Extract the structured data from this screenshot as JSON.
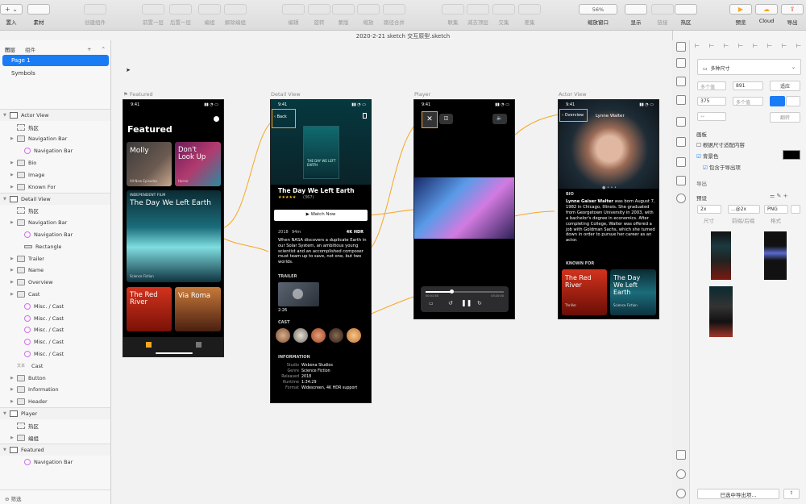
{
  "toolbar": {
    "buttons": [
      {
        "label": "置入",
        "icon": "plus-icon",
        "gray": false
      },
      {
        "label": "素材",
        "icon": "stack-icon",
        "gray": false
      },
      {
        "label": "创建组件",
        "icon": "component-icon",
        "gray": true
      },
      {
        "label": "前置一层",
        "icon": "bring-forward-icon",
        "gray": true
      },
      {
        "label": "后置一层",
        "icon": "send-backward-icon",
        "gray": true
      },
      {
        "label": "编组",
        "icon": "group-icon",
        "gray": true
      },
      {
        "label": "解除编组",
        "icon": "ungroup-icon",
        "gray": true
      },
      {
        "label": "编辑",
        "icon": "edit-icon",
        "gray": true
      },
      {
        "label": "旋转",
        "icon": "rotate-icon",
        "gray": true
      },
      {
        "label": "蒙版",
        "icon": "mask-icon",
        "gray": true
      },
      {
        "label": "缩放",
        "icon": "scale-icon",
        "gray": true
      },
      {
        "label": "路径合并",
        "icon": "flatten-icon",
        "gray": true
      },
      {
        "label": "联集",
        "icon": "union-icon",
        "gray": true
      },
      {
        "label": "减去顶层",
        "icon": "subtract-icon",
        "gray": true
      },
      {
        "label": "交集",
        "icon": "intersect-icon",
        "gray": true
      },
      {
        "label": "差集",
        "icon": "difference-icon",
        "gray": true
      },
      {
        "label": "缩放窗口",
        "icon": "zoom-icon",
        "gray": false
      },
      {
        "label": "显示",
        "icon": "view-icon",
        "gray": false
      },
      {
        "label": "链接",
        "icon": "link-icon",
        "gray": true
      },
      {
        "label": "热区",
        "icon": "hotspot-icon",
        "gray": false
      },
      {
        "label": "预览",
        "icon": "play-icon",
        "gray": false
      },
      {
        "label": "Cloud",
        "icon": "cloud-icon",
        "gray": false
      },
      {
        "label": "导出",
        "icon": "export-icon",
        "gray": false
      }
    ],
    "zoom": "56%"
  },
  "document_title": "2020-2-21 sketch 交互原型.sketch",
  "left_panel": {
    "tab_layers": "图层",
    "tab_components": "组件",
    "pages": [
      "Page 1",
      "Symbols"
    ],
    "layers": [
      {
        "label": "Actor View",
        "type": "artboard",
        "head": true,
        "level": 0
      },
      {
        "label": "热区",
        "type": "hot",
        "level": 1
      },
      {
        "label": "Navigation Bar",
        "type": "folder",
        "level": 1
      },
      {
        "label": "Navigation Bar",
        "type": "symbol",
        "level": 2
      },
      {
        "label": "Bio",
        "type": "folder",
        "level": 1
      },
      {
        "label": "Image",
        "type": "folder",
        "level": 1
      },
      {
        "label": "Known For",
        "type": "folder",
        "level": 1
      },
      {
        "label": "Detail View",
        "type": "artboard",
        "head": true,
        "level": 0
      },
      {
        "label": "热区",
        "type": "hot",
        "level": 1
      },
      {
        "label": "Navigation Bar",
        "type": "folder",
        "level": 1
      },
      {
        "label": "Navigation Bar",
        "type": "symbol",
        "level": 2
      },
      {
        "label": "Rectangle",
        "type": "rect",
        "level": 2
      },
      {
        "label": "Trailer",
        "type": "folder",
        "level": 1
      },
      {
        "label": "Name",
        "type": "folder",
        "level": 1
      },
      {
        "label": "Overview",
        "type": "folder",
        "level": 1
      },
      {
        "label": "Cast",
        "type": "folder",
        "level": 1
      },
      {
        "label": "Misc. / Cast",
        "type": "symbol",
        "level": 2
      },
      {
        "label": "Misc. / Cast",
        "type": "symbol",
        "level": 2
      },
      {
        "label": "Misc. / Cast",
        "type": "symbol",
        "level": 2
      },
      {
        "label": "Misc. / Cast",
        "type": "symbol",
        "level": 2
      },
      {
        "label": "Misc. / Cast",
        "type": "symbol",
        "level": 2
      },
      {
        "label": "Cast",
        "type": "txt",
        "level": 1
      },
      {
        "label": "Button",
        "type": "folder",
        "level": 1
      },
      {
        "label": "Information",
        "type": "folder",
        "level": 1
      },
      {
        "label": "Header",
        "type": "folder",
        "level": 1
      },
      {
        "label": "Player",
        "type": "artboard",
        "head": true,
        "level": 0
      },
      {
        "label": "热区",
        "type": "hot",
        "level": 1
      },
      {
        "label": "编组",
        "type": "folder",
        "level": 1
      },
      {
        "label": "Featured",
        "type": "artboard",
        "head": true,
        "level": 0
      },
      {
        "label": "Navigation Bar",
        "type": "symbol",
        "level": 2
      }
    ],
    "text_type_tag": "文本",
    "filter_label": "筛选"
  },
  "artboards": {
    "featured": {
      "name": "Featured",
      "time": "9:41",
      "heading": "Featured",
      "cards": [
        {
          "title": "Molly",
          "sub": "All-New Episodes"
        },
        {
          "title": "Don't Look Up",
          "sub": "Horror"
        },
        {
          "kicker": "INDEPENDENT FILM",
          "title": "The Day We Left Earth",
          "sub": "Science Fiction"
        },
        {
          "title": "The Red River",
          "sub": ""
        },
        {
          "title": "Via Roma",
          "sub": ""
        }
      ]
    },
    "detail": {
      "name": "Detail View",
      "time": "9:41",
      "back": "Back",
      "poster_text": "THE DAY WE LEFT EARTH",
      "title": "The Day We Left Earth",
      "rating": "★★★★★",
      "rating_count": "(367)",
      "watch_now": "Watch Now",
      "year": "2018",
      "duration": "94m",
      "badges": "4K  HDR",
      "description": "When NASA discovers a duplicate Earth in our Solar System, an ambitious young scientist and an accomplished composer must team up to save, not one, but two worlds.",
      "trailer_label": "TRAILER",
      "trailer_time": "2:26",
      "cast_label": "CAST",
      "info_label": "INFORMATION",
      "info": [
        {
          "k": "Studio",
          "v": "Wxbona Studios"
        },
        {
          "k": "Genre",
          "v": "Science Fiction"
        },
        {
          "k": "Released",
          "v": "2018"
        },
        {
          "k": "Runtime",
          "v": "1:34:29"
        },
        {
          "k": "Format",
          "v": "Widescreen, 4K HDR support"
        }
      ]
    },
    "player": {
      "name": "Player",
      "time": "9:41",
      "time_left": "00:01:58",
      "time_right": "03:20:00"
    },
    "actor": {
      "name": "Actor View",
      "time": "9:41",
      "back": "Overview",
      "nav_title": "Lynne Walter",
      "bio_label": "BIO",
      "bio_name": "Lynne Gaiser Walter",
      "bio_text": " was born August 7, 1982 in Chicago, Illinois. She graduated from Georgetown University in 2003, with a bachelor's degree in economics. After completing College, Walter was offered a job with Goldman Sachs, which she turned down in order to pursue her career as an actor.",
      "known_label": "KNOWN FOR",
      "known": [
        {
          "title": "The Red River",
          "sub": "Thriller"
        },
        {
          "title": "The Day We Left Earth",
          "sub": "Science Fiction"
        }
      ]
    }
  },
  "right_panel": {
    "preset": "多种尺寸",
    "multi1": "多个值",
    "height_val": "891",
    "fit_label": "适应",
    "width_val": "375",
    "multi2": "多个值",
    "flip_label": "翻转",
    "artboard_section": "画板",
    "opt_fit": "根据尺寸适配内容",
    "opt_bg": "背景色",
    "opt_include": "包含于导出项",
    "export_section": "导出",
    "preset_label": "预设",
    "export_size": "2x",
    "export_suffix": "...@2x",
    "export_format": "PNG",
    "col_size": "尺寸",
    "col_prefix": "前缀/后缀",
    "col_format": "格式",
    "export_button": "已选中导出项...",
    "bg_color": "#000000"
  },
  "accent": "#f5a623"
}
